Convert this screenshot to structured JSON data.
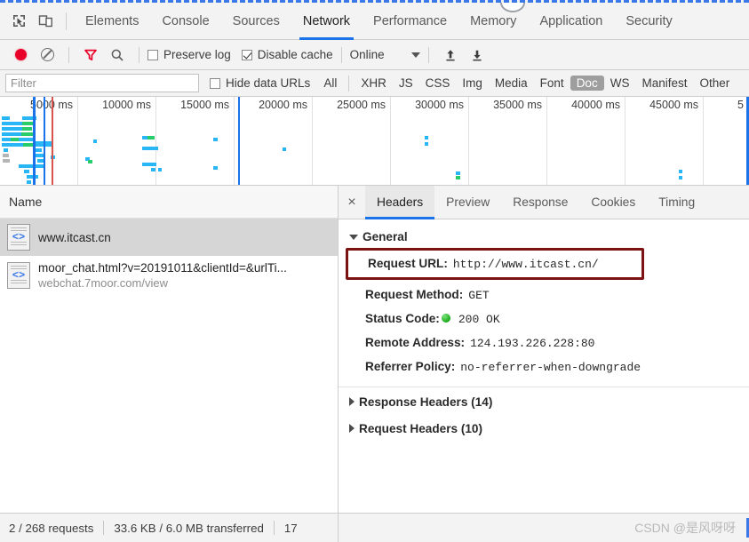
{
  "devtools": {
    "left_icons": [
      {
        "name": "inspect-element-icon",
        "label": "Inspect element"
      },
      {
        "name": "device-toolbar-icon",
        "label": "Toggle device toolbar"
      }
    ],
    "tabs": [
      {
        "label": "Elements",
        "active": false
      },
      {
        "label": "Console",
        "active": false
      },
      {
        "label": "Sources",
        "active": false
      },
      {
        "label": "Network",
        "active": true
      },
      {
        "label": "Performance",
        "active": false
      },
      {
        "label": "Memory",
        "active": false
      },
      {
        "label": "Application",
        "active": false
      },
      {
        "label": "Security",
        "active": false
      }
    ]
  },
  "toolbar": {
    "record_label": "Record",
    "clear_label": "Clear",
    "filter_icon_label": "Filter",
    "search_icon_label": "Search",
    "preserve_log": {
      "label": "Preserve log",
      "checked": false
    },
    "disable_cache": {
      "label": "Disable cache",
      "checked": true
    },
    "throttling": {
      "value": "Online"
    },
    "import_label": "Import HAR",
    "export_label": "Export HAR",
    "record_color": "#e8002a",
    "filter_color": "#e8002a"
  },
  "filter_bar": {
    "input_placeholder": "Filter",
    "input_value": "",
    "hide_data_urls": {
      "label": "Hide data URLs",
      "checked": false
    },
    "types": [
      {
        "label": "All",
        "selected": false
      },
      {
        "label": "XHR",
        "selected": false
      },
      {
        "label": "JS",
        "selected": false
      },
      {
        "label": "CSS",
        "selected": false
      },
      {
        "label": "Img",
        "selected": false
      },
      {
        "label": "Media",
        "selected": false
      },
      {
        "label": "Font",
        "selected": false
      },
      {
        "label": "Doc",
        "selected": true
      },
      {
        "label": "WS",
        "selected": false
      },
      {
        "label": "Manifest",
        "selected": false
      },
      {
        "label": "Other",
        "selected": false
      }
    ]
  },
  "overview": {
    "ticks": [
      "5000 ms",
      "10000 ms",
      "15000 ms",
      "20000 ms",
      "25000 ms",
      "30000 ms",
      "35000 ms",
      "40000 ms",
      "45000 ms",
      "5"
    ],
    "dom_content_loaded_color": "#1a73e8",
    "load_event_color": "#d9534f",
    "bar_color": "#29b6f6",
    "bar_color_alt": "#29cc6a"
  },
  "requests": {
    "column_header": "Name",
    "rows": [
      {
        "name": "www.itcast.cn",
        "subtitle": "",
        "icon": "document-icon",
        "selected": true
      },
      {
        "name": "moor_chat.html?v=20191011&clientId=&urlTi...",
        "subtitle": "webchat.7moor.com/view",
        "icon": "document-icon",
        "selected": false
      }
    ]
  },
  "detail": {
    "close_label": "×",
    "tabs": [
      {
        "label": "Headers",
        "active": true
      },
      {
        "label": "Preview",
        "active": false
      },
      {
        "label": "Response",
        "active": false
      },
      {
        "label": "Cookies",
        "active": false
      },
      {
        "label": "Timing",
        "active": false
      }
    ],
    "general": {
      "section_label": "General",
      "expanded": true,
      "request_url_key": "Request URL:",
      "request_url_value": "http://www.itcast.cn/",
      "request_method_key": "Request Method:",
      "request_method_value": "GET",
      "status_code_key": "Status Code:",
      "status_code_value": "200  OK",
      "remote_address_key": "Remote Address:",
      "remote_address_value": "124.193.226.228:80",
      "referrer_policy_key": "Referrer Policy:",
      "referrer_policy_value": "no-referrer-when-downgrade",
      "highlight_color": "#7d1212",
      "status_dot_color": "#17a817"
    },
    "response_headers_label": "Response Headers (14)",
    "request_headers_label": "Request Headers (10)"
  },
  "statusbar": {
    "requests": "2 / 268 requests",
    "transferred": "33.6 KB / 6.0 MB transferred",
    "truncated": "17",
    "watermark": "CSDN @是风呀呀"
  }
}
